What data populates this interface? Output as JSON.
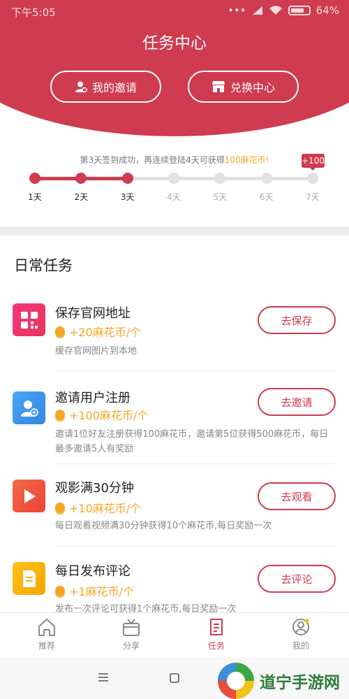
{
  "status_bar": {
    "time": "下午5:05",
    "battery": "64%"
  },
  "header": {
    "title": "任务中心",
    "invite_button": "我的邀请",
    "exchange_button": "兑换中心"
  },
  "checkin": {
    "message_prefix": "第3天签到成功，再连续登陆4天可获得",
    "message_highlight": "100麻花币!",
    "bonus_badge": "+100",
    "days": [
      "1天",
      "2天",
      "3天",
      "4天",
      "5天",
      "6天",
      "7天"
    ],
    "completed_days": 3
  },
  "daily": {
    "title": "日常任务",
    "tasks": [
      {
        "title": "保存官网地址",
        "reward": "+20麻花币/个",
        "desc": "缓存官网图片到本地",
        "button": "去保存",
        "icon": "qr-code-icon",
        "color": "#f0386b"
      },
      {
        "title": "邀请用户注册",
        "reward": "+100麻花币/个",
        "desc": "邀请1位好友注册获得100麻花币，邀请第5位获得500麻花币，每日最多邀请5人有奖励",
        "button": "去邀请",
        "icon": "add-user-icon",
        "color": "#3d97ee"
      },
      {
        "title": "观影满30分钟",
        "reward": "+10麻花币/个",
        "desc": "每日观看视频满30分钟获得10个麻花币,每日奖励一次",
        "button": "去观看",
        "icon": "play-icon",
        "color": "#f0533c"
      },
      {
        "title": "每日发布评论",
        "reward": "+1麻花币/个",
        "desc": "发布一次评论可获得1个麻花币,每日奖励一次",
        "button": "去评论",
        "icon": "document-icon",
        "color": "#f7b500"
      }
    ]
  },
  "nav": {
    "items": [
      {
        "label": "推荐",
        "icon": "home-icon"
      },
      {
        "label": "分享",
        "icon": "gift-box-icon"
      },
      {
        "label": "任务",
        "icon": "task-list-icon"
      },
      {
        "label": "我的",
        "icon": "profile-icon"
      }
    ]
  },
  "watermark": {
    "text": "道宁手游网"
  },
  "colors": {
    "primary": "#cf3b4f",
    "reward": "#f5a623"
  }
}
